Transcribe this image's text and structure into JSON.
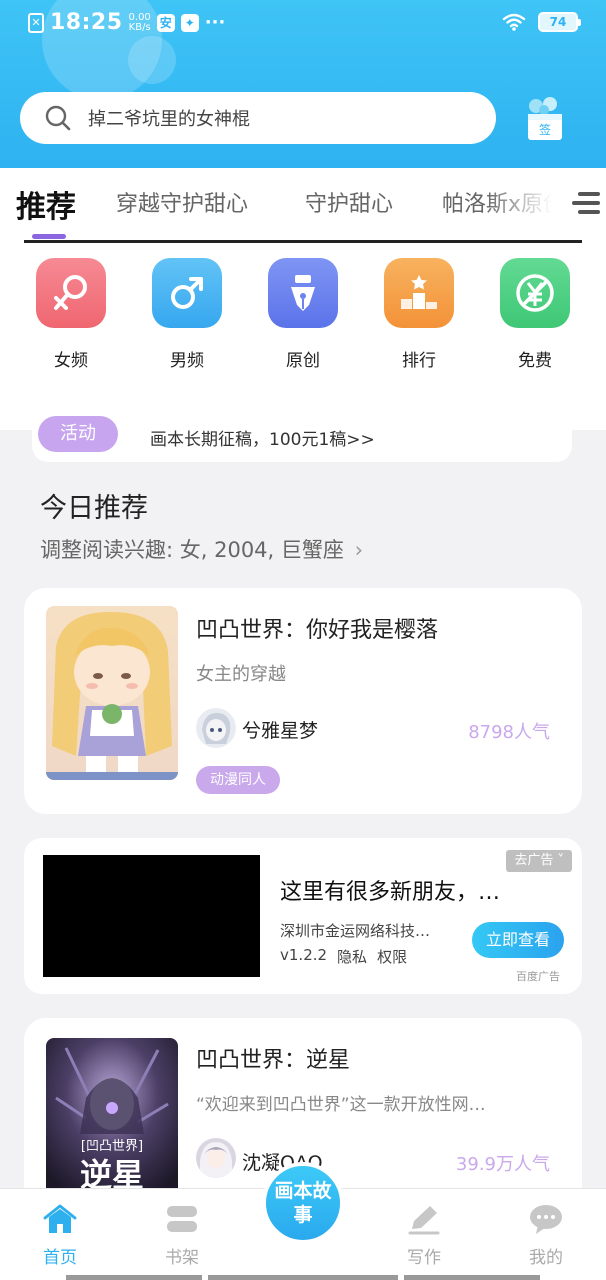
{
  "status_bar": {
    "sim": "✕",
    "time": "18:25",
    "net_speed_value": "0.00",
    "net_speed_unit": "KB/s",
    "battery": "74"
  },
  "search": {
    "placeholder": "掉二爷坑里的女神棍",
    "signin_label": "签"
  },
  "tabs": [
    {
      "label": "推荐",
      "active": true
    },
    {
      "label": "穿越守护甜心"
    },
    {
      "label": "守护甜心"
    },
    {
      "label": "帕洛斯x原创"
    }
  ],
  "categories": [
    {
      "label": "女频",
      "icon": "female-icon",
      "color": "#f2757f"
    },
    {
      "label": "男频",
      "icon": "male-icon",
      "color": "#43b0f2"
    },
    {
      "label": "原创",
      "icon": "pen-nib-icon",
      "color": "#6b84ee"
    },
    {
      "label": "排行",
      "icon": "podium-icon",
      "color": "#f6a04b"
    },
    {
      "label": "免费",
      "icon": "yuan-free-icon",
      "color": "#4dcf83"
    }
  ],
  "activity": {
    "badge": "活动",
    "text": "画本长期征稿，100元1稿>>"
  },
  "today": {
    "title": "今日推荐",
    "subtitle": "调整阅读兴趣: 女, 2004, 巨蟹座"
  },
  "books": [
    {
      "title": "凹凸世界：你好我是樱落",
      "desc": "女主的穿越",
      "author": "兮雅星梦",
      "popularity": "8798人气",
      "tag": "动漫同人"
    },
    {
      "title": "凹凸世界：逆星",
      "desc": "“欢迎来到凹凸世界”这一款开放性网…",
      "author": "沈凝QAQ",
      "popularity": "39.9万人气",
      "cover_text_top": "[凹凸世界]",
      "cover_text_big": "逆星"
    }
  ],
  "ad": {
    "close_label": "去广告 ˅",
    "title": "这里有很多新朋友，…",
    "company": "深圳市金运网络科技…",
    "version": "v1.2.2",
    "privacy": "隐私",
    "permission": "权限",
    "button": "立即查看",
    "source": "百度广告"
  },
  "bottom_nav": {
    "home": "首页",
    "shelf": "书架",
    "center": "画本故事",
    "write": "写作",
    "mine": "我的"
  },
  "colors": {
    "header_blue": "#2eb2f1",
    "accent_purple": "#c9a8ec",
    "tab_indicator": "#8c66e0"
  }
}
